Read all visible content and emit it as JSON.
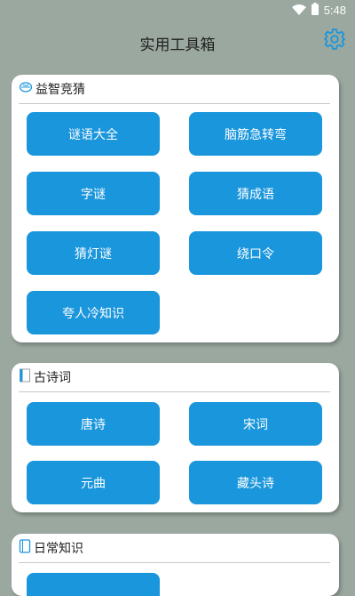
{
  "status_bar": {
    "time": "5:48"
  },
  "header": {
    "title": "实用工具箱"
  },
  "sections": [
    {
      "title": "益智竞猜",
      "items": [
        "谜语大全",
        "脑筋急转弯",
        "字谜",
        "猜成语",
        "猜灯谜",
        "绕口令",
        "夸人冷知识"
      ]
    },
    {
      "title": "古诗词",
      "items": [
        "唐诗",
        "宋词",
        "元曲",
        "藏头诗"
      ]
    },
    {
      "title": "日常知识",
      "items": []
    }
  ],
  "colors": {
    "background": "#9aa8a0",
    "tile": "#1a96dc",
    "settings_icon": "#1a96dc"
  }
}
